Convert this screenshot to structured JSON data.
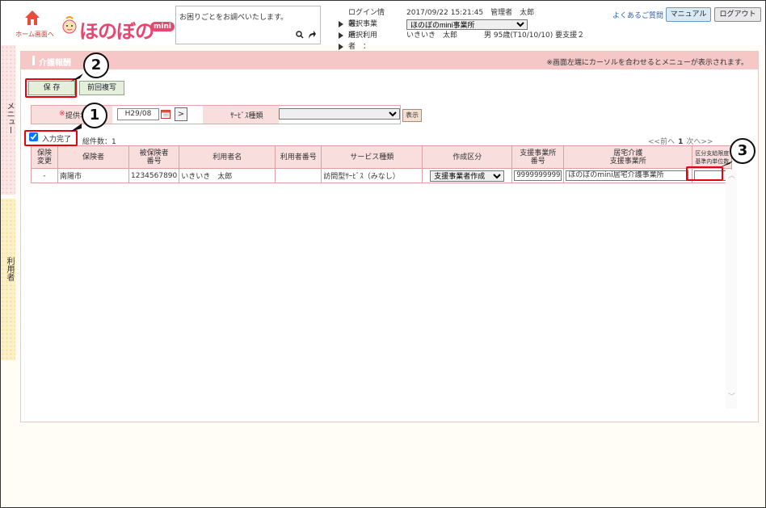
{
  "header": {
    "home_label": "ホーム画面へ",
    "logo_text": "ほのぼの",
    "logo_mini": "mini",
    "search_text": "お困りごとをお調べいたします。",
    "login_label": "ログイン情報：",
    "login_value": "2017/09/22 15:21:45　管理者　太郎",
    "office_label": "選択事業所　：",
    "office_value": "ほのぼのmini事業所",
    "user_label": "選択利用者　：",
    "user_value": "いきいき　太郎",
    "user_detail": "男 95歳(T10/10/10) 要支援２",
    "faq_label": "よくあるご質問",
    "manual_label": "マニュアル",
    "logout_label": "ログアウト"
  },
  "side": {
    "menu_label": "メニュー",
    "user_label": "利用者"
  },
  "panel": {
    "title": "介護報酬",
    "hint": "※画面左端にカーソルを合わせるとメニューが表示されます。",
    "save_label": "保 存",
    "copy_label": "前回複写",
    "filter": {
      "required_mark": "※",
      "period_label": "提供年",
      "period_value": "H29/08",
      "next_label": ">",
      "service_label": "ｻｰﾋﾞｽ種類",
      "service_value": ""
    },
    "show_label": "表示",
    "complete_label": "入力完了",
    "total_label": "総件数：1",
    "pager": {
      "prev": "<<前へ",
      "page": "1",
      "next": "次へ>>"
    }
  },
  "table": {
    "headers": [
      "保険\n変更",
      "保険者",
      "被保険者\n番号",
      "利用者名",
      "利用者番号",
      "サービス種類",
      "作成区分",
      "支援事業所\n番号",
      "居宅介護\n支援事業所",
      "区分支給限度\n基準内単位数"
    ],
    "rows": [
      {
        "change": "-",
        "insurer": "南陽市",
        "insured_no": "1234567890",
        "user_name": "いきいき　太郎",
        "user_no": "",
        "service": "訪問型ｻｰﾋﾞｽ（みなし）",
        "creation": "支援事業者作成",
        "office_no": "9999999999",
        "office_name": "ほのぼのmini居宅介護事業所",
        "units": ""
      }
    ]
  },
  "callouts": [
    "1",
    "2",
    "3"
  ],
  "colors": {
    "title_bar": "#f5c7c7",
    "highlight": "#e8000b",
    "logo": "#e8466f"
  }
}
